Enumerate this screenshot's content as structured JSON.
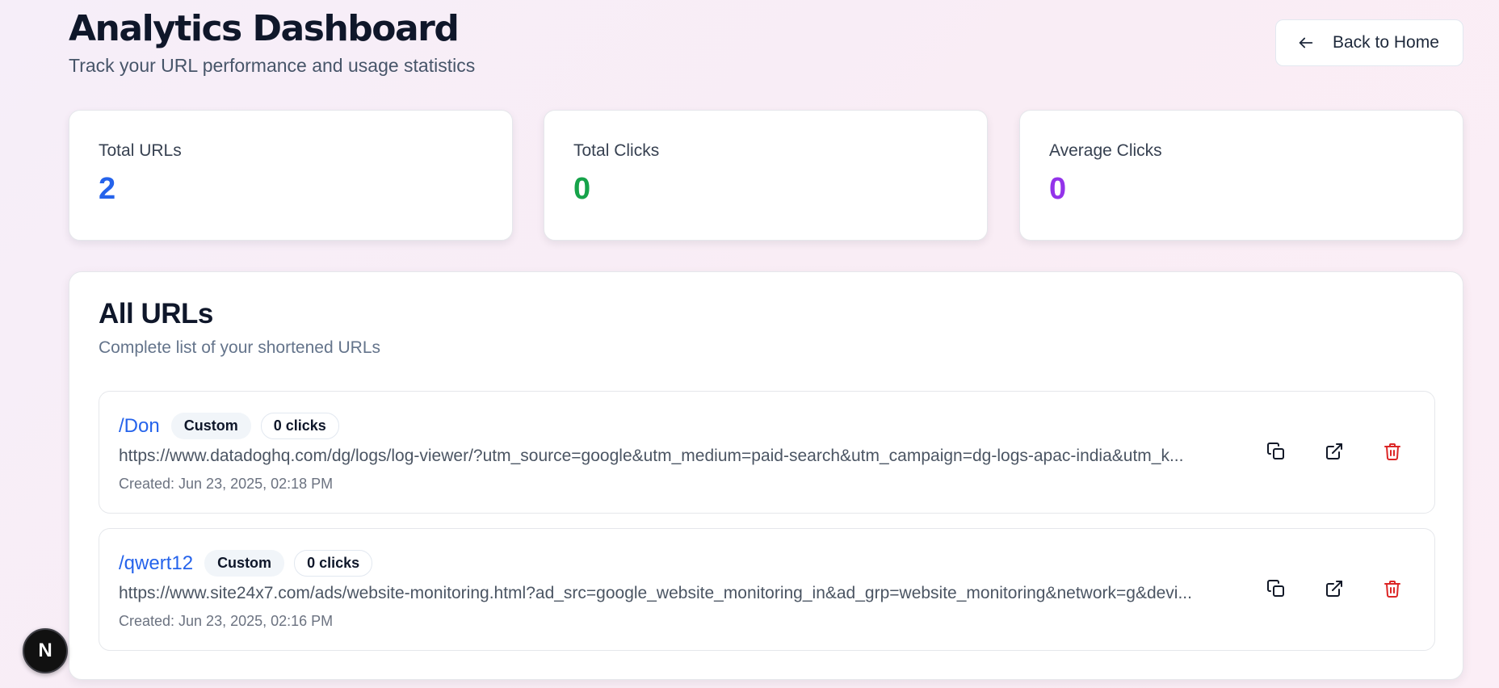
{
  "header": {
    "title": "Analytics Dashboard",
    "subtitle": "Track your URL performance and usage statistics",
    "back_label": "Back to Home"
  },
  "stats": [
    {
      "label": "Total URLs",
      "value": "2",
      "color": "#2563eb"
    },
    {
      "label": "Total Clicks",
      "value": "0",
      "color": "#16a34a"
    },
    {
      "label": "Average Clicks",
      "value": "0",
      "color": "#9333ea"
    }
  ],
  "urls_section": {
    "title": "All URLs",
    "subtitle": "Complete list of your shortened URLs",
    "items": [
      {
        "short": "/Don",
        "badge": "Custom",
        "clicks": "0 clicks",
        "original": "https://www.datadoghq.com/dg/logs/log-viewer/?utm_source=google&utm_medium=paid-search&utm_campaign=dg-logs-apac-india&utm_k...",
        "created": "Created: Jun 23, 2025, 02:18 PM"
      },
      {
        "short": "/qwert12",
        "badge": "Custom",
        "clicks": "0 clicks",
        "original": "https://www.site24x7.com/ads/website-monitoring.html?ad_src=google_website_monitoring_in&ad_grp=website_monitoring&network=g&devi...",
        "created": "Created: Jun 23, 2025, 02:16 PM"
      }
    ]
  },
  "dev_badge": "N",
  "icons": [
    "arrow-left-icon",
    "copy-icon",
    "external-link-icon",
    "trash-icon"
  ],
  "colors": {
    "link": "#2563eb",
    "delete": "#dc2626"
  }
}
